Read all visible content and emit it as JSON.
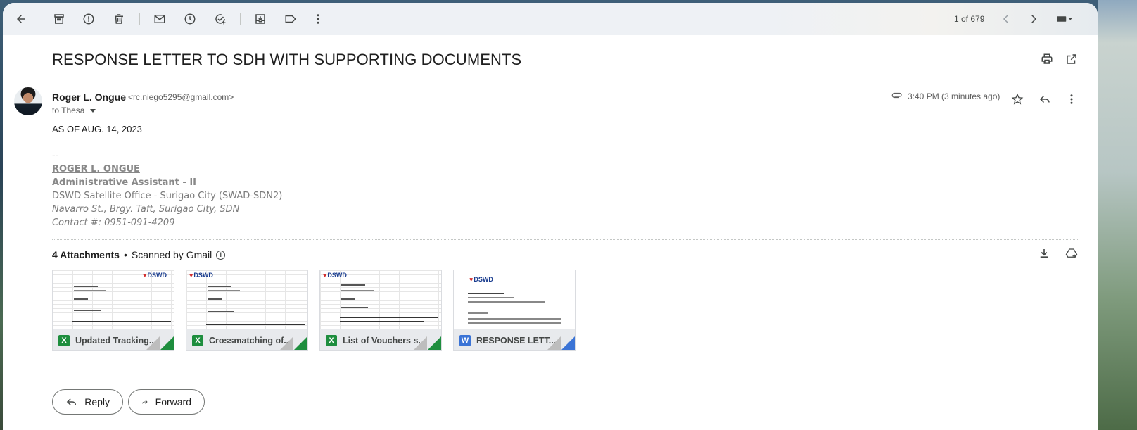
{
  "toolbar": {
    "pager": "1 of 679",
    "icons": [
      "back-arrow-icon",
      "archive-icon",
      "report-spam-icon",
      "delete-icon",
      "mark-unread-icon",
      "snooze-icon",
      "add-task-icon",
      "move-to-icon",
      "label-icon",
      "more-vert-icon",
      "prev-icon",
      "next-icon",
      "keyboard-icon"
    ]
  },
  "email": {
    "subject": "RESPONSE LETTER TO SDH WITH SUPPORTING DOCUMENTS",
    "sender_name": "Roger L. Ongue",
    "sender_email": "<rc.niego5295@gmail.com>",
    "to": "to Thesa",
    "time": "3:40 PM (3 minutes ago)",
    "body_line": "AS OF AUG. 14, 2023",
    "signature": {
      "dash": "--",
      "name": "ROGER L. ONGUE",
      "title": "Administrative Assistant - II",
      "office": "DSWD Satellite Office - Surigao City (SWAD-SDN2)",
      "address": "Navarro St., Brgy. Taft, Surigao City, SDN",
      "contact": "Contact #: 0951-091-4209"
    }
  },
  "attachments": {
    "count_label": "4 Attachments",
    "bullet": "•",
    "scanned_label": "Scanned by Gmail",
    "info_glyph": "i",
    "items": [
      {
        "name": "Updated Tracking...",
        "type": "X",
        "logo": "DSWD"
      },
      {
        "name": "Crossmatching of...",
        "type": "X",
        "logo": "DSWD"
      },
      {
        "name": "List of Vouchers s...",
        "type": "X",
        "logo": "DSWD"
      },
      {
        "name": "RESPONSE LETT...",
        "type": "W",
        "logo": "DSWD"
      }
    ]
  },
  "actions": {
    "reply_label": "Reply",
    "forward_label": "Forward"
  },
  "colors": {
    "excel": "#1e8e3e",
    "word": "#3b74d6",
    "toolbar_bg": "#eef1f5"
  }
}
